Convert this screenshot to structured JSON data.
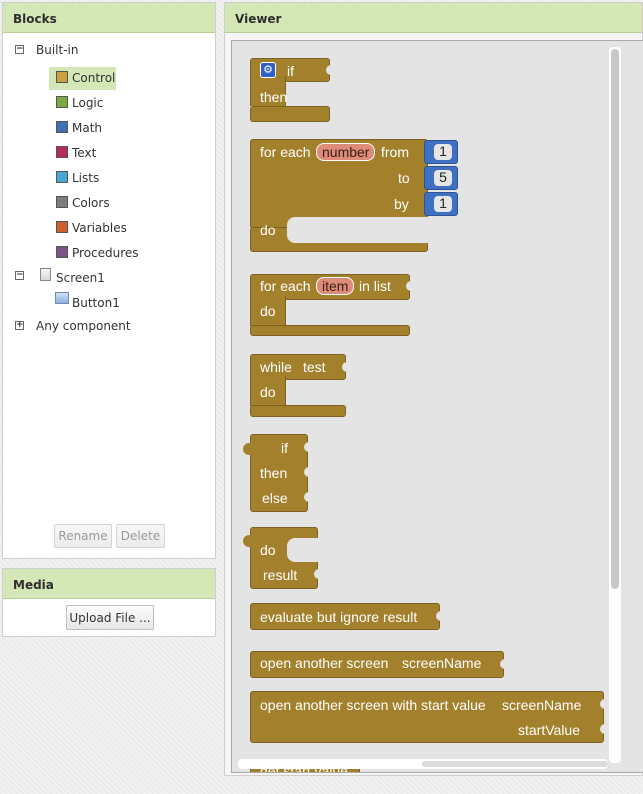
{
  "blocks_panel": {
    "title": "Blocks",
    "builtin_label": "Built-in",
    "builtin_items": [
      {
        "label": "Control",
        "color": "#c8a23f"
      },
      {
        "label": "Logic",
        "color": "#77ab41"
      },
      {
        "label": "Math",
        "color": "#3f71b5"
      },
      {
        "label": "Text",
        "color": "#b32d5e"
      },
      {
        "label": "Lists",
        "color": "#49a6d4"
      },
      {
        "label": "Colors",
        "color": "#7d7d7d"
      },
      {
        "label": "Variables",
        "color": "#d05f2d"
      },
      {
        "label": "Procedures",
        "color": "#7c5385"
      }
    ],
    "screen_label": "Screen1",
    "screen_child_label": "Button1",
    "any_component_label": "Any component",
    "rename_label": "Rename",
    "delete_label": "Delete"
  },
  "media_panel": {
    "title": "Media",
    "upload_label": "Upload File ..."
  },
  "viewer": {
    "title": "Viewer",
    "if_block": {
      "if": "if",
      "then": "then"
    },
    "for_range_block": {
      "head": "for each",
      "var": "number",
      "from": "from",
      "to": "to",
      "by": "by",
      "do": "do",
      "from_value": "1",
      "to_value": "5",
      "by_value": "1"
    },
    "for_list_block": {
      "head": "for each",
      "var": "item",
      "in_list": "in list",
      "do": "do"
    },
    "while_block": {
      "head": "while",
      "test": "test",
      "do": "do"
    },
    "if_expr_block": {
      "if": "if",
      "then": "then",
      "else": "else"
    },
    "do_result_block": {
      "do": "do",
      "result": "result"
    },
    "evaluate_block": {
      "label": "evaluate but ignore result"
    },
    "open_screen_block": {
      "label": "open another screen",
      "param": "screenName"
    },
    "open_screen_value_block": {
      "label": "open another screen with start value",
      "param1": "screenName",
      "param2": "startValue"
    },
    "get_start_value_block": {
      "label": "get start value"
    }
  }
}
